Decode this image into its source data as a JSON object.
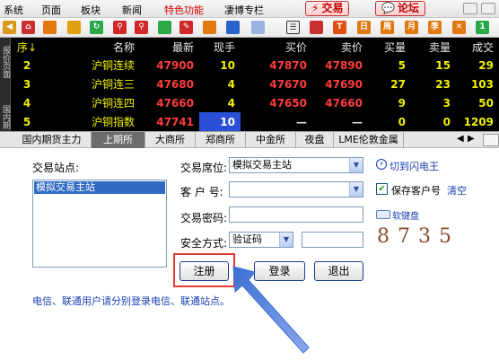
{
  "menu": {
    "items": [
      "系统",
      "页面",
      "板块",
      "新闻",
      "特色功能",
      "凄博专栏"
    ],
    "highlight_index": 4,
    "trade_button": "交易",
    "forum_button": "论坛"
  },
  "quotes": {
    "headers": [
      "序↓",
      "名称",
      "最新",
      "现手",
      "买价",
      "卖价",
      "买量",
      "卖量",
      "成交"
    ],
    "rows": [
      [
        "2",
        "沪铜连续",
        "47900",
        "10",
        "47870",
        "47890",
        "5",
        "15",
        "29"
      ],
      [
        "3",
        "沪铜连三",
        "47680",
        "4",
        "47670",
        "47690",
        "27",
        "23",
        "103"
      ],
      [
        "4",
        "沪铜连四",
        "47660",
        "4",
        "47650",
        "47660",
        "9",
        "3",
        "50"
      ],
      [
        "5",
        "沪铜指数",
        "47741",
        "10",
        "—",
        "—",
        "0",
        "0",
        "1209"
      ]
    ],
    "side_labels": [
      "报价页面",
      "国内期"
    ]
  },
  "tabs": {
    "items": [
      "国内期货主力",
      "上期所",
      "大商所",
      "郑商所",
      "中金所",
      "夜盘",
      "LME伦敦金属"
    ],
    "active_index": 1
  },
  "login": {
    "station_label": "交易站点:",
    "station_list": [
      "模拟交易主站"
    ],
    "seat_label": "交易席位:",
    "seat_value": "模拟交易主站",
    "client_label": "客 户 号:",
    "password_label": "交易密码:",
    "security_label": "安全方式:",
    "security_value": "验证码",
    "captcha": "8735",
    "switch_link": "切到闪电王",
    "save_client_label": "保存客户号",
    "clear_link": "清空",
    "soft_keyboard": "软键盘",
    "register_button": "注册",
    "login_button": "登录",
    "exit_button": "退出",
    "notice": "电信、联通用户请分别登录电信、联通站点。"
  },
  "colors": {
    "accent_red": "#e53935",
    "arrow_blue": "#3d6fd4",
    "link_blue": "#1a3fb0",
    "quote_red": "#ff3c3c",
    "quote_yellow": "#f0f000"
  }
}
